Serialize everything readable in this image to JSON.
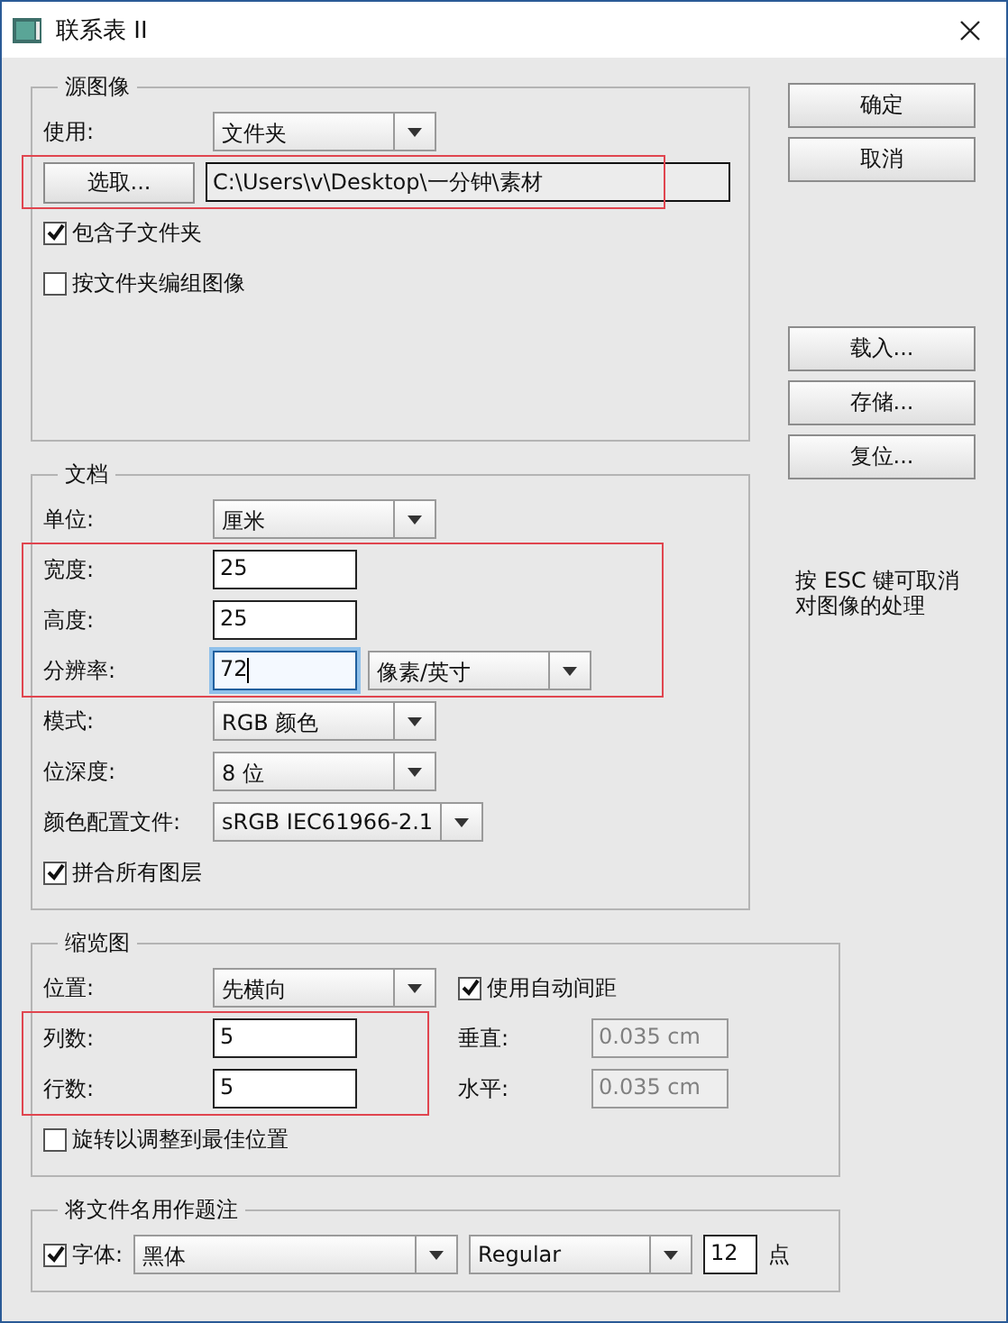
{
  "window": {
    "title": "联系表 II"
  },
  "source": {
    "title": "源图像",
    "rows": [
      {
        "kind": "select",
        "label": "使用:",
        "value": "文件夹"
      },
      {
        "kind": "highlight",
        "rows": [
          {
            "kind": "browse",
            "button": "选取...",
            "path": "C:\\Users\\v\\Desktop\\一分钟\\素材"
          }
        ]
      },
      {
        "kind": "checkbox",
        "label": "包含子文件夹",
        "checked": true
      },
      {
        "kind": "checkbox",
        "label": "按文件夹编组图像",
        "checked": false
      }
    ]
  },
  "document": {
    "title": "文档",
    "rows": [
      {
        "kind": "select",
        "label": "单位:",
        "value": "厘米"
      },
      {
        "kind": "highlight",
        "rows": [
          {
            "kind": "input",
            "label": "宽度:",
            "value": "25",
            "focused": false,
            "disabled": false
          },
          {
            "kind": "input",
            "label": "高度:",
            "value": "25",
            "focused": false,
            "disabled": false
          },
          {
            "kind": "input_select",
            "label": "分辨率:",
            "value": "72",
            "focused": true,
            "unit": "像素/英寸"
          }
        ]
      },
      {
        "kind": "select",
        "label": "模式:",
        "value": "RGB 颜色"
      },
      {
        "kind": "select",
        "label": "位深度:",
        "value": "8 位"
      },
      {
        "kind": "select",
        "label": "颜色配置文件:",
        "value": "sRGB IEC61966-2.1"
      },
      {
        "kind": "checkbox",
        "label": "拼合所有图层",
        "checked": true
      }
    ]
  },
  "thumbnails": {
    "title": "缩览图",
    "left": [
      {
        "kind": "select",
        "label": "位置:",
        "value": "先横向"
      },
      {
        "kind": "highlight",
        "rows": [
          {
            "kind": "input",
            "label": "列数:",
            "value": "5",
            "focused": false,
            "disabled": false
          },
          {
            "kind": "input",
            "label": "行数:",
            "value": "5",
            "focused": false,
            "disabled": false
          }
        ]
      }
    ],
    "right": [
      {
        "kind": "checkbox",
        "label": "使用自动间距",
        "checked": true
      },
      {
        "kind": "input",
        "label": "垂直:",
        "value": "0.035 cm",
        "focused": false,
        "disabled": true
      },
      {
        "kind": "input",
        "label": "水平:",
        "value": "0.035 cm",
        "focused": false,
        "disabled": true
      }
    ],
    "footer": [
      {
        "kind": "checkbox",
        "label": "旋转以调整到最佳位置",
        "checked": false
      }
    ]
  },
  "caption": {
    "title": "将文件名用作题注",
    "checked": true,
    "label": "字体:",
    "font": "黑体",
    "style": "Regular",
    "size": "12",
    "unit": "点"
  },
  "buttons": [
    {
      "label": "确定"
    },
    {
      "label": "取消"
    }
  ],
  "more_buttons": [
    {
      "label": "载入..."
    },
    {
      "label": "存储..."
    },
    {
      "label": "复位..."
    }
  ],
  "hint": [
    "按 ESC 键可取消",
    "对图像的处理"
  ]
}
